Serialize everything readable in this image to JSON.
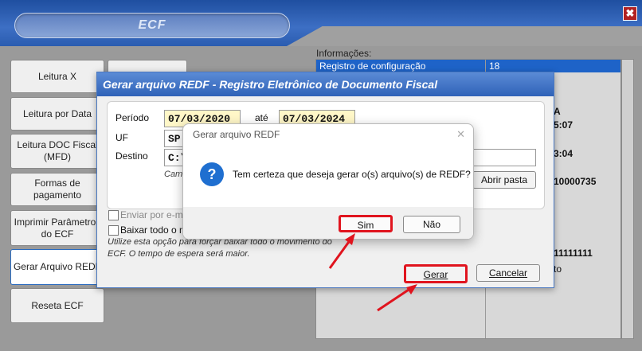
{
  "window": {
    "title": "ECF",
    "close_glyph": "✖"
  },
  "sidebar": {
    "items": [
      {
        "label": "Leitura X"
      },
      {
        "label": "Leitura por Data"
      },
      {
        "label": "Leitura DOC Fiscal (MFD)"
      },
      {
        "label": "Formas de pagamento"
      },
      {
        "label": "Imprimir Parâmetros do ECF"
      },
      {
        "label": "Gerar Arquivo REDF"
      },
      {
        "label": "Reseta ECF"
      }
    ]
  },
  "info": {
    "label": "Informações:",
    "selected_row": {
      "name": "Registro de configuração",
      "value": "18"
    },
    "visible_values": [
      "A",
      "5:07",
      "3:04",
      "10000735",
      "11111111",
      "to"
    ]
  },
  "redf_dialog": {
    "title": "Gerar arquivo REDF - Registro Eletrônico de Documento Fiscal",
    "periodo_label": "Período",
    "periodo_from": "07/03/2020",
    "ate_label": "até",
    "periodo_to": "07/03/2024",
    "uf_label": "UF",
    "uf_value": "SP",
    "destino_label": "Destino",
    "destino_value": "C:\\",
    "caminho_hint": "Cam",
    "abrir_pasta_label": "Abrir pasta",
    "enviar_email_label": "Enviar por e-m",
    "baixar_todo_label": "Baixar todo o m",
    "note": "Utilize esta opção para forçar baixar todo o movimento do ECF. O tempo de espera será maior.",
    "gerar_label": "Gerar",
    "cancelar_label": "Cancelar"
  },
  "confirm_dialog": {
    "title": "Gerar arquivo REDF",
    "close_glyph": "✕",
    "icon_glyph": "?",
    "message": "Tem certeza que deseja gerar o(s) arquivo(s) de REDF?",
    "sim_label": "Sim",
    "nao_label": "Não"
  },
  "colors": {
    "highlight": "#e0141e",
    "title_blue": "#2f62b8",
    "selection_blue": "#1e63c8"
  }
}
